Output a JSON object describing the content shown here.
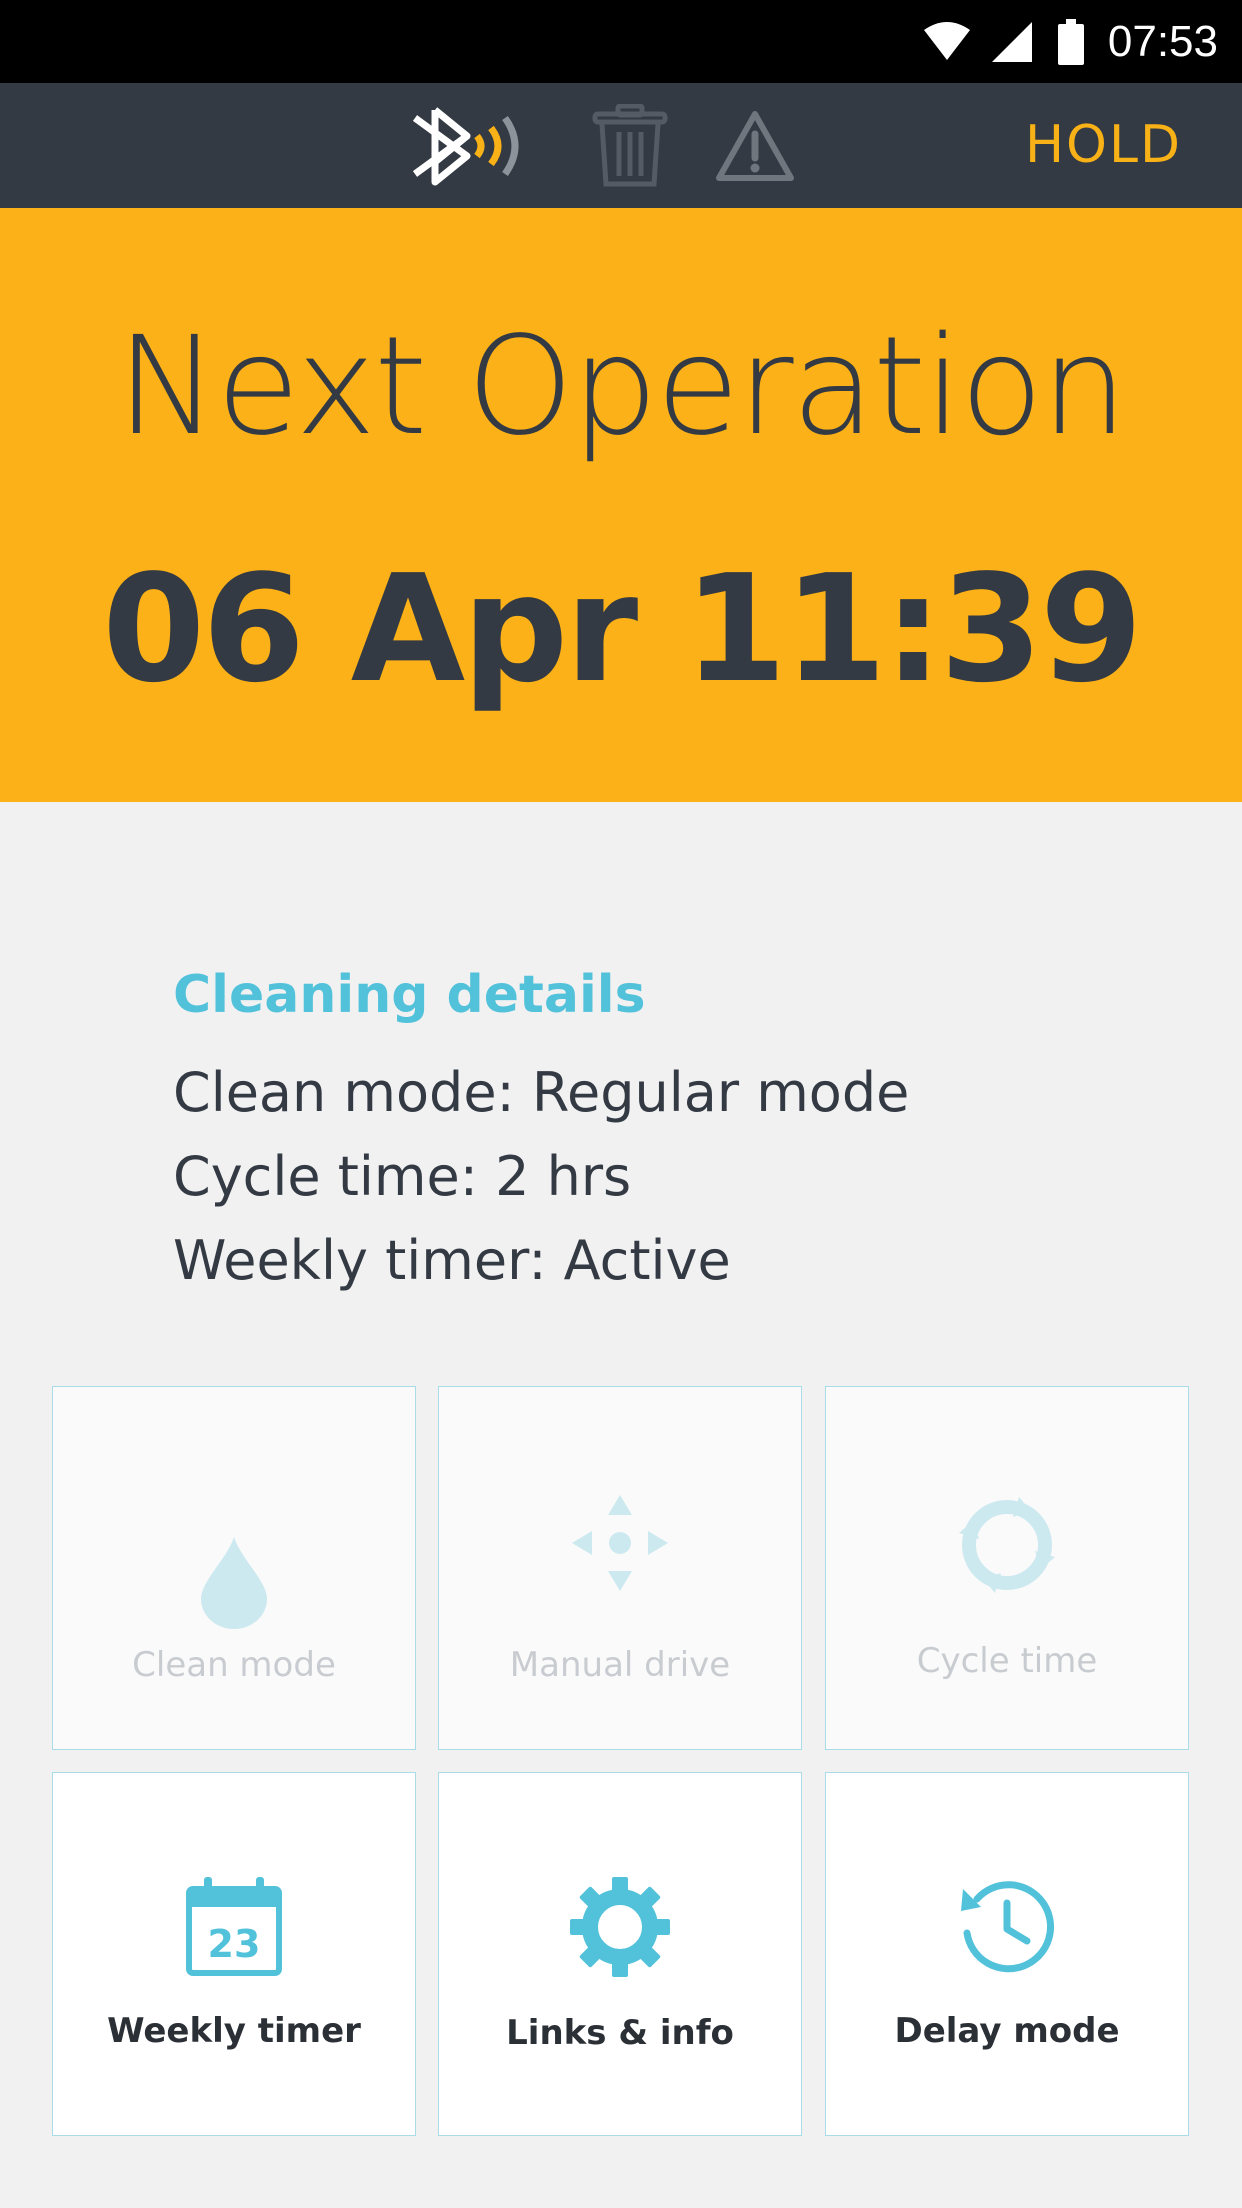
{
  "status_bar": {
    "time": "07:53"
  },
  "toolbar": {
    "hold_label": "HOLD"
  },
  "hero": {
    "title": "Next Operation",
    "datetime": "06 Apr 11:39"
  },
  "details": {
    "title": "Cleaning details",
    "lines": [
      "Clean mode: Regular mode",
      "Cycle time: 2 hrs",
      "Weekly timer: Active"
    ]
  },
  "tiles": [
    {
      "label": "Clean mode",
      "icon": "droplet-icon",
      "enabled": false
    },
    {
      "label": "Manual drive",
      "icon": "move-arrows-icon",
      "enabled": false
    },
    {
      "label": "Cycle time",
      "icon": "cycle-arrows-icon",
      "enabled": false
    },
    {
      "label": "Weekly timer",
      "icon": "calendar-icon",
      "calendar_day": "23",
      "enabled": true
    },
    {
      "label": "Links & info",
      "icon": "gear-icon",
      "enabled": true
    },
    {
      "label": "Delay mode",
      "icon": "clock-history-icon",
      "enabled": true
    }
  ],
  "colors": {
    "accent_yellow": "#fbb117",
    "toolbar_dark": "#343a43",
    "accent_blue": "#52c1da"
  }
}
